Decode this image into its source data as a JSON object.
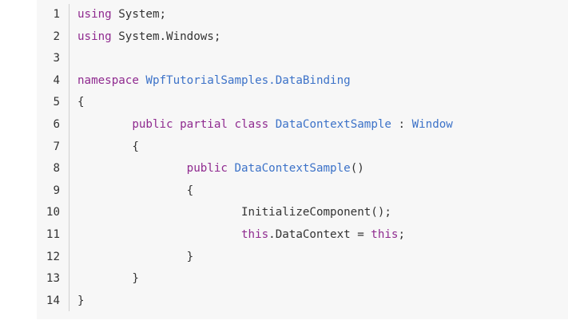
{
  "colors": {
    "background": "#f7f7f7",
    "keyword": "#8f2a8f",
    "type": "#3c72c8",
    "text": "#333333"
  },
  "code": {
    "language": "C#",
    "lines": [
      {
        "number": "1",
        "indent": "",
        "tokens": [
          {
            "t": "kw",
            "v": "using"
          },
          {
            "t": "plain",
            "v": " System;"
          }
        ]
      },
      {
        "number": "2",
        "indent": "",
        "tokens": [
          {
            "t": "kw",
            "v": "using"
          },
          {
            "t": "plain",
            "v": " System.Windows;"
          }
        ]
      },
      {
        "number": "3",
        "indent": "",
        "tokens": []
      },
      {
        "number": "4",
        "indent": "",
        "tokens": [
          {
            "t": "kw",
            "v": "namespace"
          },
          {
            "t": "plain",
            "v": " "
          },
          {
            "t": "type",
            "v": "WpfTutorialSamples.DataBinding"
          }
        ]
      },
      {
        "number": "5",
        "indent": "",
        "tokens": [
          {
            "t": "plain",
            "v": "{"
          }
        ]
      },
      {
        "number": "6",
        "indent": "        ",
        "tokens": [
          {
            "t": "kw",
            "v": "public"
          },
          {
            "t": "plain",
            "v": " "
          },
          {
            "t": "kw",
            "v": "partial"
          },
          {
            "t": "plain",
            "v": " "
          },
          {
            "t": "kw",
            "v": "class"
          },
          {
            "t": "plain",
            "v": " "
          },
          {
            "t": "type",
            "v": "DataContextSample"
          },
          {
            "t": "plain",
            "v": " : "
          },
          {
            "t": "type",
            "v": "Window"
          }
        ]
      },
      {
        "number": "7",
        "indent": "        ",
        "tokens": [
          {
            "t": "plain",
            "v": "{"
          }
        ]
      },
      {
        "number": "8",
        "indent": "                ",
        "tokens": [
          {
            "t": "kw",
            "v": "public"
          },
          {
            "t": "plain",
            "v": " "
          },
          {
            "t": "type",
            "v": "DataContextSample"
          },
          {
            "t": "plain",
            "v": "()"
          }
        ]
      },
      {
        "number": "9",
        "indent": "                ",
        "tokens": [
          {
            "t": "plain",
            "v": "{"
          }
        ]
      },
      {
        "number": "10",
        "indent": "                        ",
        "tokens": [
          {
            "t": "plain",
            "v": "InitializeComponent();"
          }
        ]
      },
      {
        "number": "11",
        "indent": "                        ",
        "tokens": [
          {
            "t": "kw",
            "v": "this"
          },
          {
            "t": "plain",
            "v": ".DataContext = "
          },
          {
            "t": "kw",
            "v": "this"
          },
          {
            "t": "plain",
            "v": ";"
          }
        ]
      },
      {
        "number": "12",
        "indent": "                ",
        "tokens": [
          {
            "t": "plain",
            "v": "}"
          }
        ]
      },
      {
        "number": "13",
        "indent": "        ",
        "tokens": [
          {
            "t": "plain",
            "v": "}"
          }
        ]
      },
      {
        "number": "14",
        "indent": "",
        "tokens": [
          {
            "t": "plain",
            "v": "}"
          }
        ]
      }
    ]
  }
}
